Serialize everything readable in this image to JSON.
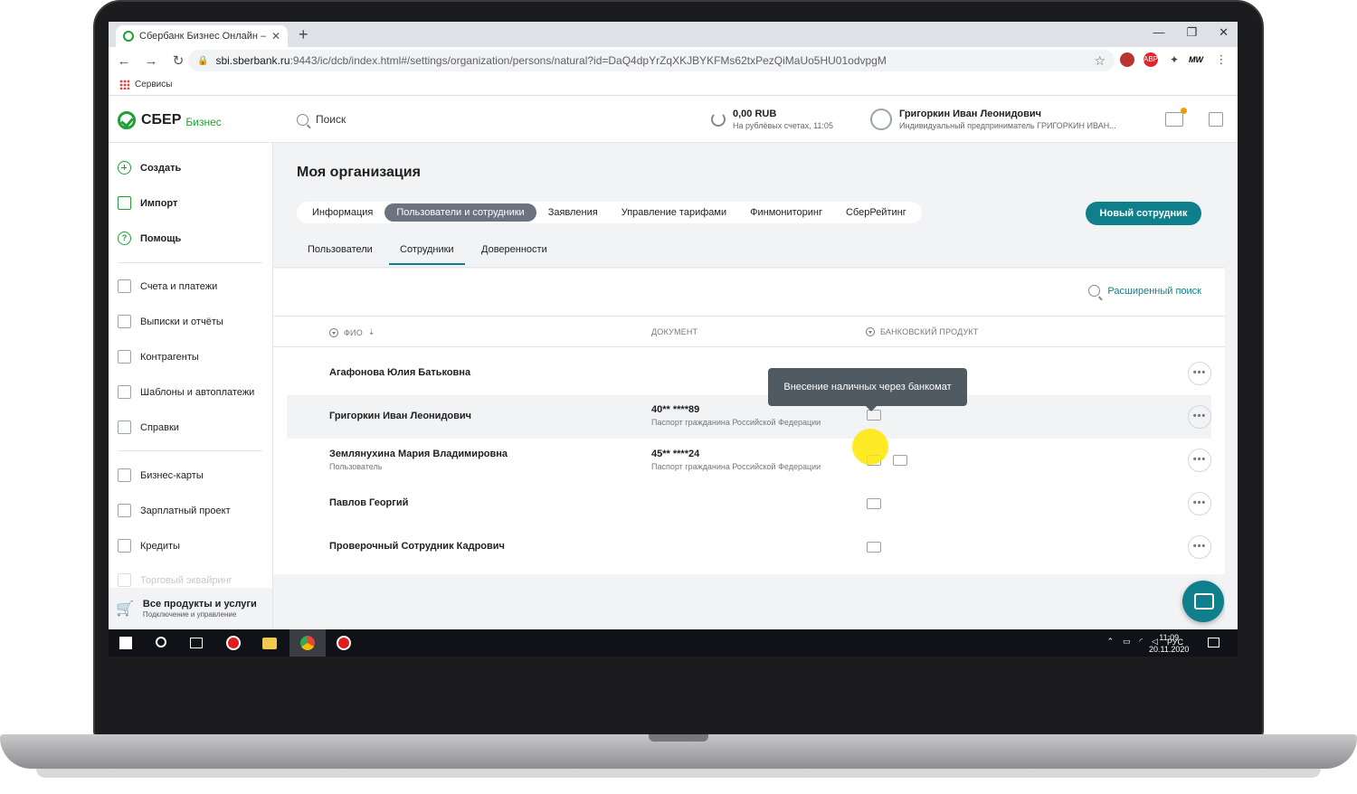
{
  "browser": {
    "tab_title": "Сбербанк Бизнес Онлайн — Ин",
    "url_host": "sbi.sberbank.ru",
    "url_path": ":9443/ic/dcb/index.html#/settings/organization/persons/natural?id=DaQ4dpYrZqXKJBYKFMs62txPezQiMaUo5HU01odvpgM",
    "bookmarks_label": "Сервисы",
    "ext_abp": "ABP",
    "ext_mw": "MW"
  },
  "header": {
    "logo_text": "СБЕР",
    "logo_sub": "Бизнес",
    "search_label": "Поиск",
    "balance_amount": "0,00 RUB",
    "balance_sub": "На рублёвых счетах, 11:05",
    "user_name": "Григоркин Иван Леонидович",
    "user_sub": "Индивидуальный предприниматель ГРИГОРКИН ИВАН..."
  },
  "sidebar": {
    "top_items": [
      {
        "label": "Создать"
      },
      {
        "label": "Импорт"
      },
      {
        "label": "Помощь"
      }
    ],
    "items": [
      {
        "label": "Счета и платежи"
      },
      {
        "label": "Выписки и отчёты"
      },
      {
        "label": "Контрагенты"
      },
      {
        "label": "Шаблоны и автоплатежи"
      },
      {
        "label": "Справки"
      },
      {
        "label": "Бизнес-карты"
      },
      {
        "label": "Зарплатный проект"
      },
      {
        "label": "Кредиты"
      },
      {
        "label": "Торговый эквайринг"
      }
    ],
    "bottom_title": "Все продукты и услуги",
    "bottom_sub": "Подключение и управление"
  },
  "main": {
    "page_title": "Моя организация",
    "tabs": [
      {
        "label": "Информация"
      },
      {
        "label": "Пользователи и сотрудники"
      },
      {
        "label": "Заявления"
      },
      {
        "label": "Управление тарифами"
      },
      {
        "label": "Финмониторинг"
      },
      {
        "label": "СберРейтинг"
      }
    ],
    "new_employee_button": "Новый сотрудник",
    "subtabs": [
      {
        "label": "Пользователи"
      },
      {
        "label": "Сотрудники"
      },
      {
        "label": "Доверенности"
      }
    ],
    "advanced_search": "Расширенный поиск",
    "columns": {
      "name": "ФИО",
      "document": "ДОКУМЕНТ",
      "product": "БАНКОВСКИЙ ПРОДУКТ"
    },
    "rows": [
      {
        "name": "Агафонова Юлия Батьковна",
        "role": "",
        "doc": "",
        "doc_sub": ""
      },
      {
        "name": "Григоркин Иван Леонидович",
        "role": "",
        "doc": "40** ****89",
        "doc_sub": "Паспорт гражданина Российской Федерации"
      },
      {
        "name": "Землянухина Мария Владимировна",
        "role": "Пользователь",
        "doc": "45** ****24",
        "doc_sub": "Паспорт гражданина Российской Федерации"
      },
      {
        "name": "Павлов Георгий",
        "role": "",
        "doc": "",
        "doc_sub": ""
      },
      {
        "name": "Проверочный Сотрудник Кадрович",
        "role": "",
        "doc": "",
        "doc_sub": ""
      }
    ],
    "more_glyph": "•••",
    "tooltip": "Внесение наличных через банкомат"
  },
  "taskbar": {
    "lang": "РУС",
    "time": "11:09",
    "date": "20.11.2020"
  },
  "colors": {
    "accent": "#107f8c",
    "brand_green": "#21a038",
    "tab_active": "#6b7280"
  }
}
